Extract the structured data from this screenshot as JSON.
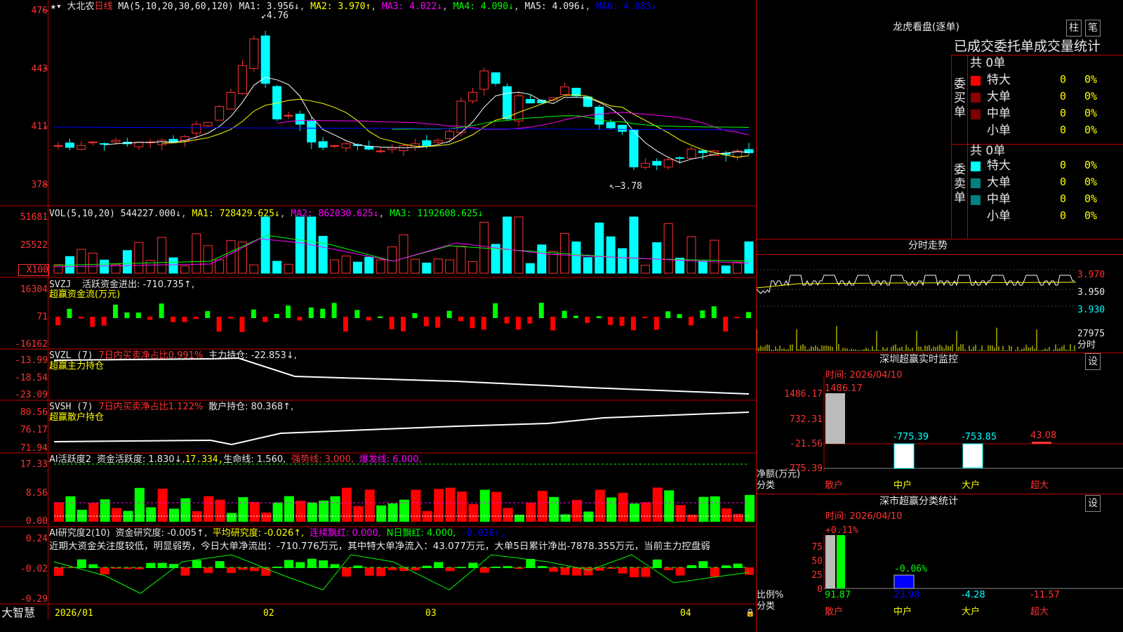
{
  "stock": {
    "name": "大北农",
    "period": "日线"
  },
  "ma_line": {
    "label": "MA(5,10,20,30,60,120)",
    "ma1": "MA1: 3.956↓",
    "ma2": "MA2: 3.970↑",
    "ma3": "MA3: 4.022↓",
    "ma4": "MA4: 4.090↓",
    "ma5": "MA5: 4.096↓",
    "ma6": "MA6: 4.083↓"
  },
  "price_axis": [
    "476",
    "443",
    "411",
    "378"
  ],
  "price_annotations": {
    "high": "4.76",
    "low": "3.78"
  },
  "vol_line": {
    "label": "VOL(5,10,20)",
    "value": "544227.000↓",
    "ma1": "MA1: 728429.625↓",
    "ma2": "MA2: 862030.625↓",
    "ma3": "MA3: 1192608.625↓"
  },
  "vol_axis": [
    "51681",
    "25522",
    "X100"
  ],
  "svzj": {
    "label": "SVZJ",
    "text": "活跃资金进出: -710.735↑,",
    "sub": "超赢资金流(万元)",
    "axis": [
      "16304",
      "71",
      "-16162"
    ]
  },
  "svzl": {
    "label": "SVZL (7)",
    "text1": "7日内买卖净占比0.991%",
    "text2": "主力持仓: -22.853↓,",
    "sub": "超赢主力持仓",
    "axis": [
      "-13.99",
      "-18.54",
      "-23.09"
    ]
  },
  "svsh": {
    "label": "SVSH (7)",
    "text1": "7日内买卖净占比1.122%",
    "text2": "散户持仓: 80.368↑,",
    "sub": "超赢散户持仓",
    "axis": [
      "80.56",
      "76.17",
      "71.94"
    ]
  },
  "ai1": {
    "label": "AI活跃度2",
    "t1": "资金活跃度: 1.830↓,",
    "t2": "17.334,",
    "t3": "生命线: 1.560,",
    "t4": "强势线: 3.000,",
    "t5": "爆发线: 6.000,",
    "axis": [
      "17.33",
      "8.56",
      "0.00"
    ]
  },
  "ai2": {
    "label": "AI研究度2(10)",
    "t1": "资金研究度: -0.005↑,",
    "t2": "平均研究度: -0.026↑,",
    "t3": "连续飘红: 0.000,",
    "t4": "N日飘红: 4.000,",
    "t5": "-0.026↑,",
    "axis": [
      "0.24",
      "-0.02",
      "-0.29"
    ],
    "note": "近期大资金关注度较低，明显弱势，今日大单净流出：-710.776万元，其中特大单净流入：43.077万元，大单5日累计净出-7878.355万元，当前主力控盘弱"
  },
  "bottom": {
    "brand": "大智慧",
    "dates": [
      "2026/01",
      "02",
      "03",
      "04"
    ]
  },
  "right": {
    "lhb_title": "龙虎看盘(逐单)",
    "btn_zhu": "柱",
    "btn_bi": "笔",
    "tabs": "已成交委托单成交量统计",
    "buy_side": "委买单",
    "sell_side": "委卖单",
    "buy_total": "共 0单",
    "sell_total": "共 0单",
    "buy_rows": [
      {
        "label": "特大",
        "count": "0",
        "pct": "0%",
        "color": "#ff0000"
      },
      {
        "label": "大单",
        "count": "0",
        "pct": "0%",
        "color": "#8b0000"
      },
      {
        "label": "中单",
        "count": "0",
        "pct": "0%",
        "color": "#800000"
      },
      {
        "label": "小单",
        "count": "0",
        "pct": "0%",
        "color": "#000000"
      }
    ],
    "sell_rows": [
      {
        "label": "特大",
        "count": "0",
        "pct": "0%",
        "color": "#00ffff"
      },
      {
        "label": "大单",
        "count": "0",
        "pct": "0%",
        "color": "#008080"
      },
      {
        "label": "中单",
        "count": "0",
        "pct": "0%",
        "color": "#008080"
      },
      {
        "label": "小单",
        "count": "0",
        "pct": "0%",
        "color": "#000000"
      }
    ],
    "intraday_title": "分时走势",
    "intraday_axis": [
      "3.970",
      "3.950",
      "3.930"
    ],
    "intraday_vol": "27975",
    "intraday_vol_unit": "分时",
    "sz_monitor_title": "深圳超赢实时监控",
    "sz_set": "设",
    "sz_time": "时间: 2026/04/10",
    "sz_axis": [
      "1486.17",
      "732.31",
      "-21.56",
      "-775.39"
    ],
    "sz_unit": "净额(万元)",
    "sz_cat": "分类",
    "sz_bars": [
      {
        "cat": "散户",
        "value": "1486.17"
      },
      {
        "cat": "中户",
        "value": "-775.39"
      },
      {
        "cat": "大户",
        "value": "-753.85"
      },
      {
        "cat": "超大",
        "value": "43.08"
      }
    ],
    "sh_title": "深市超赢分类统计",
    "sh_set": "设",
    "sh_time": "时间: 2026/04/10",
    "sh_axis": [
      "75",
      "50",
      "25",
      "0"
    ],
    "sh_unit": "比例%",
    "sh_cat": "分类",
    "sh_top": [
      "+0.11%",
      "-0.06%"
    ],
    "sh_bars": [
      {
        "cat": "散户",
        "value": "91.87"
      },
      {
        "cat": "中户",
        "value": "23.98"
      },
      {
        "cat": "大户",
        "value": "-4.28"
      },
      {
        "cat": "超大",
        "value": "-11.57"
      }
    ]
  },
  "chart_data": {
    "type": "bar",
    "title": "大北农 日线",
    "ylim": [
      3.78,
      4.76
    ],
    "categories": [
      "2026/01",
      "02",
      "03",
      "04"
    ],
    "series": [
      {
        "name": "MA1",
        "values": [
          3.956
        ]
      },
      {
        "name": "MA2",
        "values": [
          3.97
        ]
      },
      {
        "name": "MA3",
        "values": [
          4.022
        ]
      }
    ]
  }
}
